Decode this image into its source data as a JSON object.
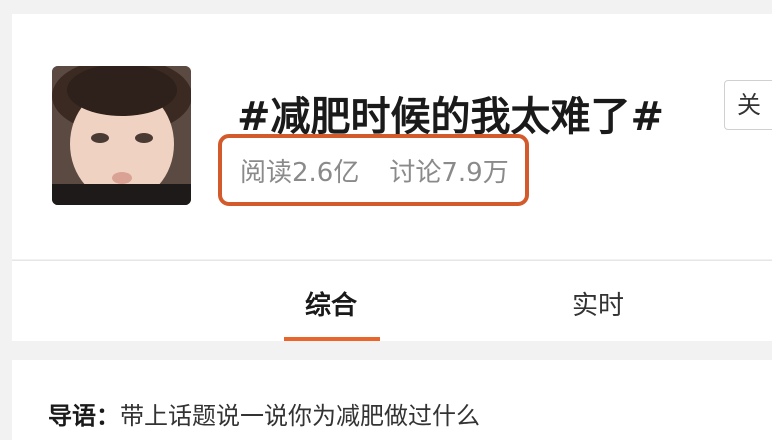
{
  "topic": {
    "title": "#减肥时候的我太难了#",
    "reads": "阅读2.6亿",
    "discussions": "讨论7.9万",
    "follow_label": "关"
  },
  "tabs": [
    {
      "label": "综合",
      "active": true
    },
    {
      "label": "实时",
      "active": false
    }
  ],
  "intro": {
    "label": "导语：",
    "text": "带上话题说一说你为减肥做过什么"
  },
  "colors": {
    "highlight_border": "#d35a2a",
    "active_tab_underline": "#e8652c"
  }
}
